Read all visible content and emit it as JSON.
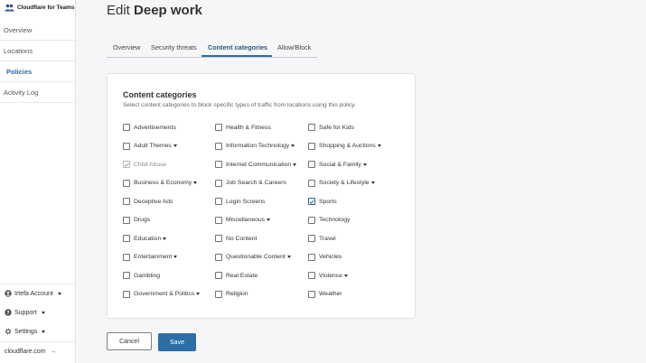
{
  "brand": {
    "name": "Cloudflare for Teams"
  },
  "sidebar": {
    "items": [
      {
        "label": "Overview"
      },
      {
        "label": "Locations"
      },
      {
        "label": "Policies"
      },
      {
        "label": "Activity Log"
      }
    ],
    "footer": {
      "account": "Irtefa Account",
      "support": "Support",
      "settings": "Settings",
      "domain": "cloudflare.com",
      "domain_arrow": "→"
    }
  },
  "page": {
    "title_prefix": "Edit",
    "title_name": "Deep work"
  },
  "tabs": [
    {
      "label": "Overview"
    },
    {
      "label": "Security threats"
    },
    {
      "label": "Content categories"
    },
    {
      "label": "Allow/Block"
    }
  ],
  "card": {
    "title": "Content categories",
    "description": "Select content categories to block specific types of traffic from locations using this policy."
  },
  "categories": {
    "col1": [
      {
        "label": "Advertisements",
        "checked": false,
        "dropdown": false
      },
      {
        "label": "Adult Themes",
        "checked": false,
        "dropdown": true
      },
      {
        "label": "Child Abuse",
        "checked": true,
        "disabled": true,
        "dropdown": false
      },
      {
        "label": "Business & Economy",
        "checked": false,
        "dropdown": true
      },
      {
        "label": "Deceptive Ads",
        "checked": false,
        "dropdown": false
      },
      {
        "label": "Drugs",
        "checked": false,
        "dropdown": false
      },
      {
        "label": "Education",
        "checked": false,
        "dropdown": true
      },
      {
        "label": "Entertainment",
        "checked": false,
        "dropdown": true
      },
      {
        "label": "Gambling",
        "checked": false,
        "dropdown": false
      },
      {
        "label": "Government & Politics",
        "checked": false,
        "dropdown": true
      }
    ],
    "col2": [
      {
        "label": "Health & Fitness",
        "checked": false,
        "dropdown": false
      },
      {
        "label": "Information Technology",
        "checked": false,
        "dropdown": true
      },
      {
        "label": "Internet Communication",
        "checked": false,
        "dropdown": true
      },
      {
        "label": "Job Search & Careers",
        "checked": false,
        "dropdown": false
      },
      {
        "label": "Login Screens",
        "checked": false,
        "dropdown": false
      },
      {
        "label": "Miscellaneous",
        "checked": false,
        "dropdown": true
      },
      {
        "label": "No Content",
        "checked": false,
        "dropdown": false
      },
      {
        "label": "Questionable Content",
        "checked": false,
        "dropdown": true
      },
      {
        "label": "Real Estate",
        "checked": false,
        "dropdown": false
      },
      {
        "label": "Religion",
        "checked": false,
        "dropdown": false
      }
    ],
    "col3": [
      {
        "label": "Safe for Kids",
        "checked": false,
        "dropdown": false
      },
      {
        "label": "Shopping & Auctions",
        "checked": false,
        "dropdown": true
      },
      {
        "label": "Social & Family",
        "checked": false,
        "dropdown": true
      },
      {
        "label": "Society & Lifestyle",
        "checked": false,
        "dropdown": true
      },
      {
        "label": "Sports",
        "checked": true,
        "dropdown": false
      },
      {
        "label": "Technology",
        "checked": false,
        "dropdown": false
      },
      {
        "label": "Travel",
        "checked": false,
        "dropdown": false
      },
      {
        "label": "Vehicles",
        "checked": false,
        "dropdown": false
      },
      {
        "label": "Violence",
        "checked": false,
        "dropdown": true
      },
      {
        "label": "Weather",
        "checked": false,
        "dropdown": false
      }
    ]
  },
  "actions": {
    "cancel": "Cancel",
    "save": "Save"
  },
  "colors": {
    "accent": "#2d6ea8",
    "active_nav": "#2c6a9e"
  },
  "icons": {
    "brand": "people-icon",
    "account": "user-icon",
    "support": "help-icon",
    "settings": "gear-icon",
    "domain_arrow": "arrow-right-icon"
  }
}
